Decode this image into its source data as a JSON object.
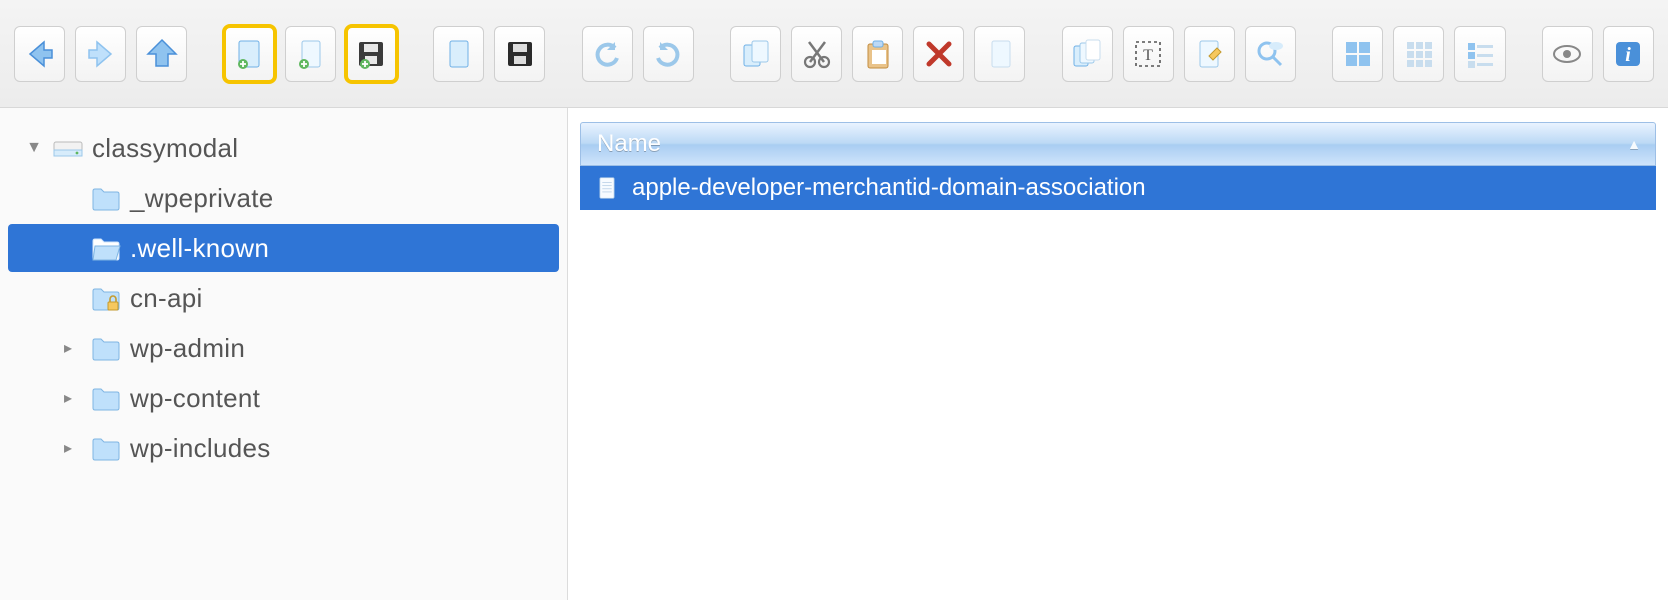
{
  "toolbar": {
    "buttons": [
      {
        "name": "nav-back-button",
        "icon": "arrow-left-icon",
        "hl": false
      },
      {
        "name": "nav-fwd-button",
        "icon": "arrow-right-icon",
        "hl": false
      },
      {
        "name": "nav-up-button",
        "icon": "arrow-up-icon",
        "hl": false
      },
      {
        "sep": true
      },
      {
        "name": "new-file-button",
        "icon": "file-new-icon",
        "hl": true
      },
      {
        "name": "new-file2-button",
        "icon": "file-new2-icon",
        "hl": false
      },
      {
        "name": "save-file-button",
        "icon": "save-icon",
        "hl": true
      },
      {
        "sep": true
      },
      {
        "name": "paste-file-button",
        "icon": "file-plain-icon",
        "hl": false
      },
      {
        "name": "save-dark-button",
        "icon": "save-dark-icon",
        "hl": false
      },
      {
        "sep": true
      },
      {
        "name": "undo-button",
        "icon": "undo-icon",
        "hl": false
      },
      {
        "name": "redo-button",
        "icon": "redo-icon",
        "hl": false
      },
      {
        "sep": true
      },
      {
        "name": "copy-button",
        "icon": "copy-icon",
        "hl": false
      },
      {
        "name": "cut-button",
        "icon": "cut-icon",
        "hl": false
      },
      {
        "name": "clipboard-button",
        "icon": "clipboard-icon",
        "hl": false
      },
      {
        "name": "delete-button",
        "icon": "delete-icon",
        "hl": false
      },
      {
        "name": "blank-file-button",
        "icon": "file-blank-icon",
        "hl": false
      },
      {
        "sep": true
      },
      {
        "name": "copy-multi-button",
        "icon": "copy-multi-icon",
        "hl": false
      },
      {
        "name": "select-text-button",
        "icon": "select-text-icon",
        "hl": false
      },
      {
        "name": "edit-file-button",
        "icon": "file-edit-icon",
        "hl": false
      },
      {
        "name": "search-cloud-button",
        "icon": "search-cloud-icon",
        "hl": false
      },
      {
        "sep": true
      },
      {
        "name": "view-large-button",
        "icon": "grid-large-blue-icon",
        "hl": false
      },
      {
        "name": "view-small-button",
        "icon": "grid-small-icon",
        "hl": false
      },
      {
        "name": "view-detail-button",
        "icon": "grid-detail-icon",
        "hl": false
      },
      {
        "sep": true
      },
      {
        "name": "preview-button",
        "icon": "eye-icon",
        "hl": false
      },
      {
        "name": "info-button",
        "icon": "info-icon",
        "hl": false
      }
    ]
  },
  "tree": {
    "root": {
      "label": "classymodal",
      "expanded": true
    },
    "children": [
      {
        "label": "_wpeprivate",
        "icon": "folder",
        "expandable": false,
        "selected": false
      },
      {
        "label": ".well-known",
        "icon": "folder-open",
        "expandable": false,
        "selected": true
      },
      {
        "label": "cn-api",
        "icon": "folder-locked",
        "expandable": false,
        "selected": false
      },
      {
        "label": "wp-admin",
        "icon": "folder",
        "expandable": true,
        "selected": false
      },
      {
        "label": "wp-content",
        "icon": "folder",
        "expandable": true,
        "selected": false
      },
      {
        "label": "wp-includes",
        "icon": "folder",
        "expandable": true,
        "selected": false
      }
    ]
  },
  "filelist": {
    "column_header": "Name",
    "rows": [
      {
        "name": "apple-developer-merchantid-domain-association",
        "selected": true
      }
    ]
  }
}
